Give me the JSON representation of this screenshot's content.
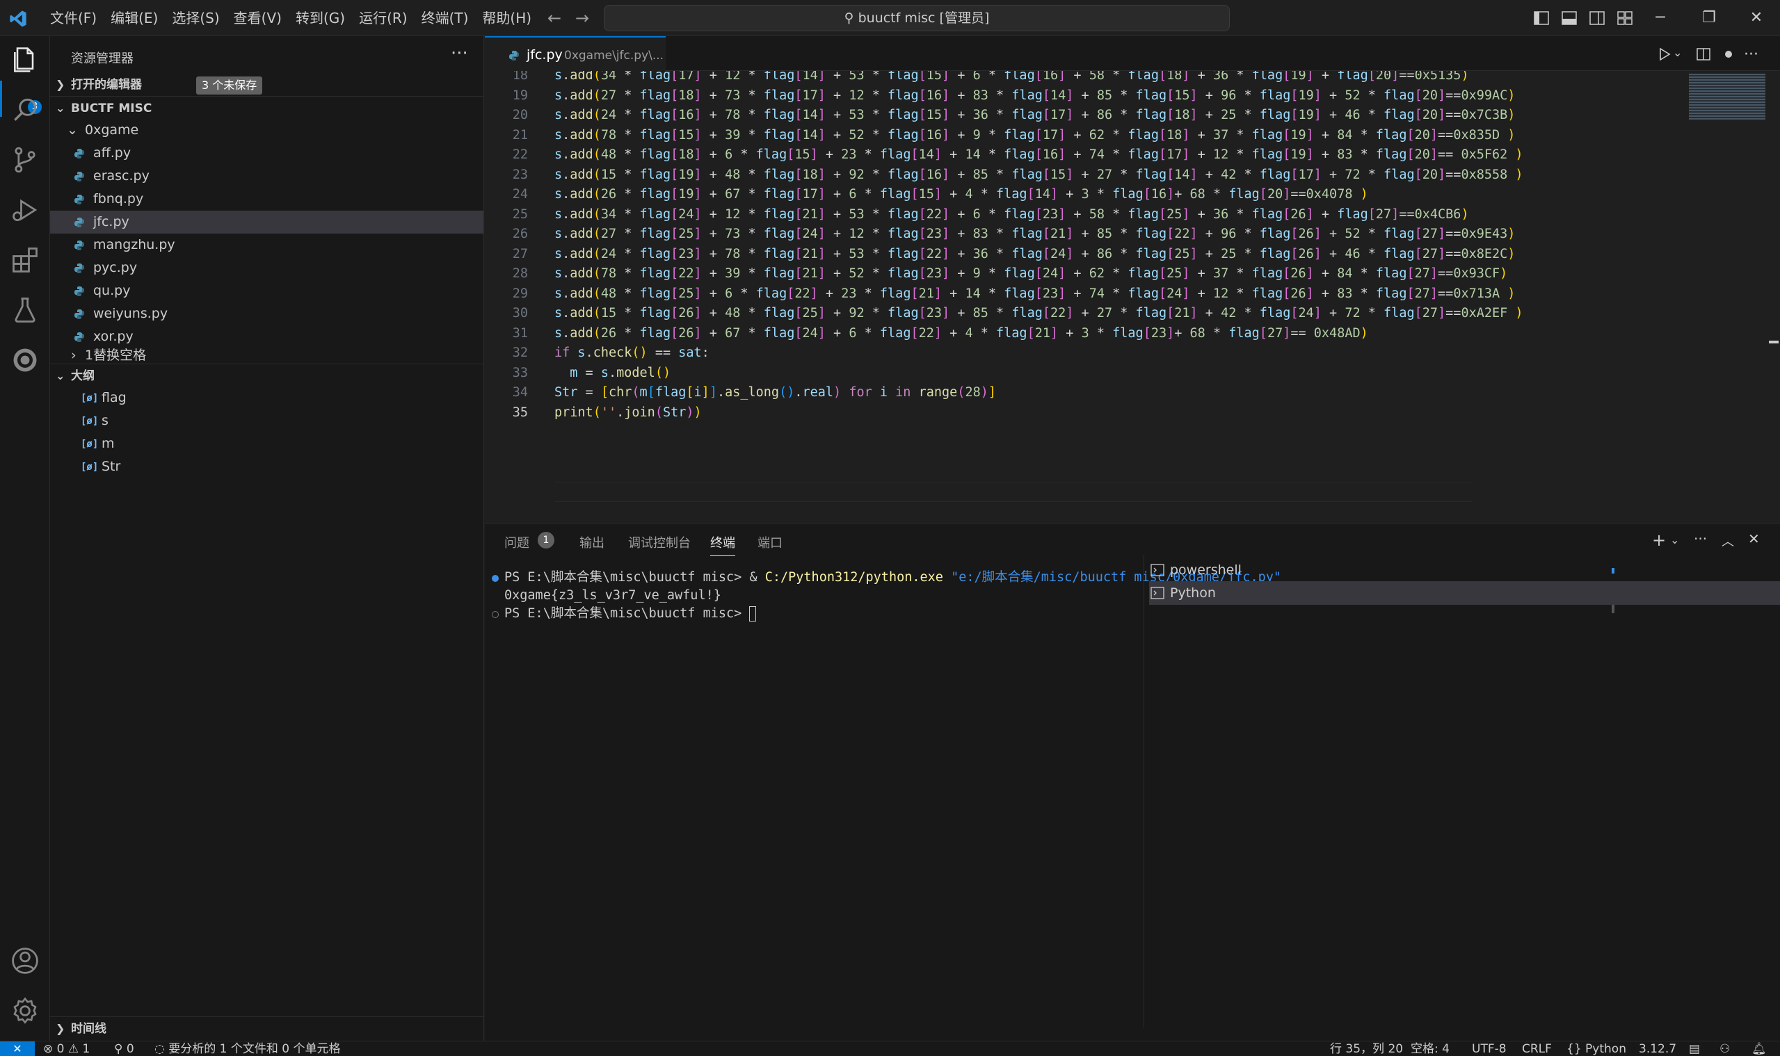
{
  "menu": [
    "文件(F)",
    "编辑(E)",
    "选择(S)",
    "查看(V)",
    "转到(G)",
    "运行(R)",
    "终端(T)",
    "帮助(H)"
  ],
  "command_center": "buuctf misc [管理员]",
  "activity_badge": "3",
  "sidebar": {
    "title": "资源管理器",
    "open_editors": "打开的编辑器",
    "unsaved": "3 个未保存",
    "folder": "BUCTF MISC",
    "subfolder": "0xgame",
    "files": [
      "aff.py",
      "erasc.py",
      "fbnq.py",
      "jfc.py",
      "mangzhu.py",
      "pyc.py",
      "qu.py",
      "weiyuns.py",
      "xor.py"
    ],
    "selected_file": "jfc.py",
    "collapsed_folder": "1替换空格",
    "outline_title": "大纲",
    "outline_items": [
      "flag",
      "s",
      "m",
      "Str"
    ],
    "timeline": "时间线"
  },
  "tab": {
    "name": "jfc.py",
    "path": "0xgame\\jfc.py\\..."
  },
  "editor": {
    "line_numbers": [
      "18",
      "19",
      "20",
      "21",
      "22",
      "23",
      "24",
      "25",
      "26",
      "27",
      "28",
      "29",
      "30",
      "31",
      "32",
      "33",
      "34",
      "35"
    ],
    "current_line": "35"
  },
  "panel": {
    "tabs": [
      "问题",
      "输出",
      "调试控制台",
      "终端",
      "端口"
    ],
    "active_tab": "终端",
    "problems_count": "1",
    "terminal": {
      "prompt1": "PS E:\\脚本合集\\misc\\buuctf misc> ",
      "cmd_amp": "& ",
      "cmd_exe": "C:/Python312/python.exe",
      "cmd_arg": "\"e:/脚本合集/misc/buuctf misc/0xgame/jfc.py\"",
      "output": "0xgame{z3_ls_v3r7_ve_awful!}",
      "prompt2": "PS E:\\脚本合集\\misc\\buuctf misc> "
    },
    "terminal_list": [
      "powershell",
      "Python"
    ],
    "selected_terminal": "Python"
  },
  "status": {
    "errors": "0",
    "warnings": "1",
    "ports": "0",
    "analysis": "要分析的 1 个文件和 0 个单元格",
    "position": "行 35，列 20",
    "spaces": "空格: 4",
    "encoding": "UTF-8",
    "eol": "CRLF",
    "language": "Python",
    "version": "3.12.7"
  },
  "colors": {
    "accent": "#0078d4",
    "background": "#1f1f1f",
    "sidebar": "#181818"
  }
}
